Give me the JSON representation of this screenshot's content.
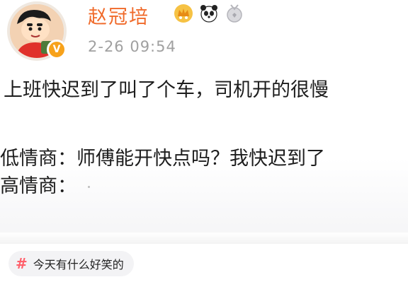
{
  "post": {
    "username": "赵冠培",
    "timestamp": "2-26 09:54",
    "verified_badge": "V",
    "badges": [
      "crown-badge-icon",
      "panda-badge-icon",
      "medal-badge-icon"
    ],
    "lines": [
      "上班快迟到了叫了个车，司机开的很慢",
      "低情商：师傅能开快点吗？我快迟到了",
      "高情商："
    ]
  },
  "topic": {
    "hash": "#",
    "label": "今天有什么好笑的"
  },
  "colors": {
    "username": "#f06a2a",
    "verified": "#f7a21b",
    "topic_hash": "#ff5f6a"
  }
}
